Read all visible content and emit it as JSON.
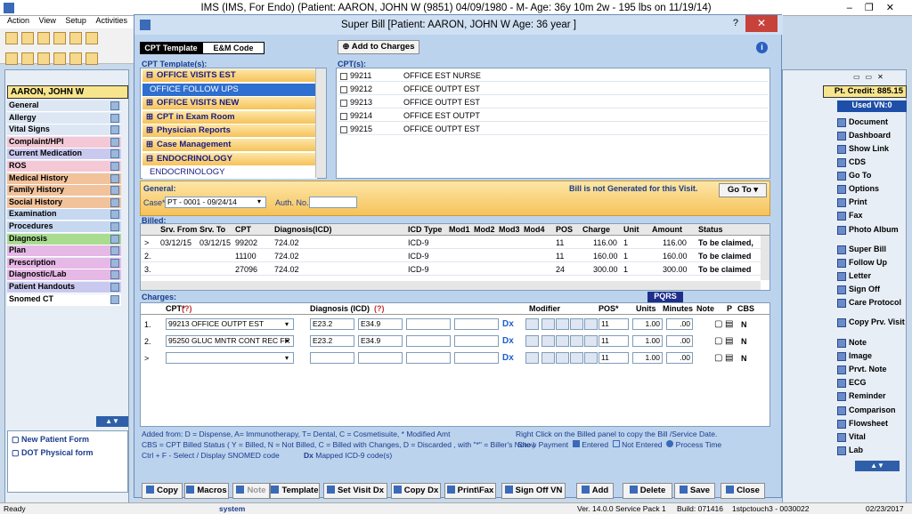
{
  "app": {
    "title": "IMS (IMS, For Endo)    (Patient: AARON, JOHN W (9851) 04/09/1980 - M- Age: 36y 10m 2w - 195 lbs on 11/19/14)",
    "menu": [
      "Action",
      "View",
      "Setup",
      "Activities"
    ],
    "patient_name": "AARON, JOHN W",
    "pt_credit": "Pt. Credit: 885.15",
    "used_vn": "Used VN:0"
  },
  "left_nav": [
    {
      "label": "General",
      "color": "#dde7f4"
    },
    {
      "label": "Allergy",
      "color": "#dde7f4"
    },
    {
      "label": "Vital Signs",
      "color": "#dde7f4"
    },
    {
      "label": "Complaint/HPI",
      "color": "#f4c8d4"
    },
    {
      "label": "Current Medication",
      "color": "#c9c9f0"
    },
    {
      "label": "ROS",
      "color": "#f4c8d4"
    },
    {
      "label": "Medical History",
      "color": "#f2c29b"
    },
    {
      "label": "Family History",
      "color": "#f2c29b"
    },
    {
      "label": "Social History",
      "color": "#f2c29b"
    },
    {
      "label": "Examination",
      "color": "#c6d7f0"
    },
    {
      "label": "Procedures",
      "color": "#c6d7f0"
    },
    {
      "label": "Diagnosis",
      "color": "#a9dc8f"
    },
    {
      "label": "Plan",
      "color": "#e6b8e6"
    },
    {
      "label": "Prescription",
      "color": "#e6b8e6"
    },
    {
      "label": "Diagnostic/Lab",
      "color": "#e6b8e6"
    },
    {
      "label": "Patient Handouts",
      "color": "#c9c9f0"
    },
    {
      "label": "Snomed CT",
      "color": "#ffffff"
    }
  ],
  "left_forms": [
    "New Patient Form",
    "DOT Physical form"
  ],
  "dialog": {
    "title": "Super Bill  [Patient: AARON, JOHN W  Age: 36 year ]",
    "help": "?",
    "close": "✕",
    "tabs": [
      "CPT Template",
      "E&M Code"
    ],
    "add_to_charges": "Add to Charges",
    "cpt_templates_label": "CPT Template(s):",
    "cpts_label": "CPT(s):",
    "templates": [
      {
        "label": "OFFICE VISITS EST",
        "sign": "⊟"
      },
      {
        "label": "OFFICE FOLLOW UPS",
        "sign": ""
      },
      {
        "label": "OFFICE VISITS NEW",
        "sign": "⊞"
      },
      {
        "label": "CPT in Exam Room",
        "sign": "⊞"
      },
      {
        "label": "Physician Reports",
        "sign": "⊞"
      },
      {
        "label": "Case Management",
        "sign": "⊞"
      },
      {
        "label": "ENDOCRINOLOGY",
        "sign": "⊟"
      },
      {
        "label": "ENDOCRINOLOGY",
        "sign": ""
      }
    ],
    "cpts": [
      {
        "code": "99211",
        "desc": "OFFICE EST NURSE"
      },
      {
        "code": "99212",
        "desc": "OFFICE OUTPT EST"
      },
      {
        "code": "99213",
        "desc": "OFFICE OUTPT EST"
      },
      {
        "code": "99214",
        "desc": "OFFICE EST OUTPT"
      },
      {
        "code": "99215",
        "desc": "OFFICE OUTPT EST"
      }
    ],
    "general_label": "General:",
    "bill_status": "Bill is not Generated for this Visit.",
    "goto": "Go To",
    "case_label": "Case*",
    "case_value": "PT - 0001 - 09/24/14",
    "auth_label": "Auth. No.:",
    "billed_label": "Billed:",
    "billed_headers": [
      "Srv. From",
      "Srv. To",
      "CPT",
      "Diagnosis(ICD)",
      "ICD Type",
      "Mod1",
      "Mod2",
      "Mod3",
      "Mod4",
      "POS",
      "Charge",
      "Unit",
      "Amount",
      "Status"
    ],
    "billed_rows": [
      {
        "idx": ">",
        "from": "03/12/15",
        "to": "03/12/15",
        "cpt": "99202",
        "dx": "724.02",
        "type": "ICD-9",
        "pos": "11",
        "charge": "116.00",
        "unit": "1",
        "amount": "116.00",
        "status": "To be claimed, "
      },
      {
        "idx": "2.",
        "from": "",
        "to": "",
        "cpt": "11100",
        "dx": "724.02",
        "type": "ICD-9",
        "pos": "11",
        "charge": "160.00",
        "unit": "1",
        "amount": "160.00",
        "status": "To be claimed"
      },
      {
        "idx": "3.",
        "from": "",
        "to": "",
        "cpt": "27096",
        "dx": "724.02",
        "type": "ICD-9",
        "pos": "24",
        "charge": "300.00",
        "unit": "1",
        "amount": "300.00",
        "status": "To be claimed"
      }
    ],
    "charges_label": "Charges:",
    "pqrs": "PQRS",
    "charge_headers": {
      "cpt": "CPT*",
      "dx": "Diagnosis (ICD)",
      "modifier": "Modifier",
      "pos": "POS*",
      "units": "Units",
      "minutes": "Minutes",
      "note": "Note",
      "p": "P",
      "cbs": "CBS",
      "q": "(?)"
    },
    "charge_rows": [
      {
        "idx": "1.",
        "cpt": "99213   OFFICE OUTPT EST",
        "dx1": "E23.2",
        "dx2": "E34.9",
        "pos": "11",
        "units": "1.00",
        "minutes": ".00",
        "cbs": "N"
      },
      {
        "idx": "2.",
        "cpt": "95250   GLUC MNTR CONT REC FR",
        "dx1": "E23.2",
        "dx2": "E34.9",
        "pos": "11",
        "units": "1.00",
        "minutes": ".00",
        "cbs": "N"
      },
      {
        "idx": ">",
        "cpt": "",
        "dx1": "",
        "dx2": "",
        "pos": "11",
        "units": "1.00",
        "minutes": ".00",
        "cbs": "N"
      }
    ],
    "dx_mark": "Dx",
    "notes": [
      "Added from: D = Dispense, A= Immunotherapy, T= Dental,  C = Cosmetisuite,  * Modified Amt",
      "CBS = CPT Billed Status ( Y = Billed, N = Not Billed, C = Billed with Changes, D = Discarded , with \"*\" = Biller's Note )",
      "Ctrl + F - Select / Display SNOMED code"
    ],
    "right_note": "Right Click on the Billed panel to copy the Bill /Service Date.",
    "legend": [
      "Show Payment",
      "Entered",
      "Not Entered",
      "Process Time"
    ],
    "mapped": "Mapped ICD-9 code(s)",
    "buttons": [
      "Copy",
      "Macros",
      "Note",
      "Template",
      "Set Visit Dx",
      "Copy Dx",
      "Print\\Fax",
      "Sign Off VN",
      "Add",
      "Delete",
      "Save",
      "Close"
    ]
  },
  "right_nav": [
    "Document",
    "Dashboard",
    "Show Link",
    "CDS",
    "Go To",
    "Options",
    "Print",
    "Fax",
    "Photo Album",
    "Super Bill",
    "Follow Up",
    "Letter",
    "Sign Off",
    "Care Protocol",
    "Copy Prv. Visit",
    "Note",
    "Image",
    "Prvt. Note",
    "ECG",
    "Reminder",
    "Comparison",
    "Flowsheet",
    "Vital",
    "Lab"
  ],
  "status": {
    "left": "Ready",
    "user": "system",
    "version": "Ver. 14.0.0 Service Pack 1",
    "build": "Build: 071416",
    "machine": "1stpctouch3 - 0030022",
    "date": "02/23/2017"
  }
}
